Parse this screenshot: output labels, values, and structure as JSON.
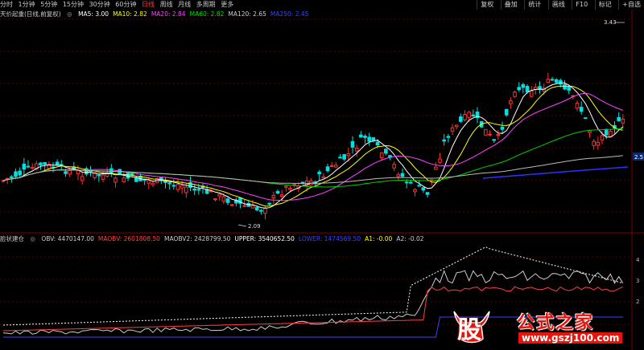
{
  "toolbar": {
    "periods": [
      "分时",
      "1分钟",
      "5分钟",
      "15分钟",
      "30分钟",
      "60分钟",
      "日线",
      "周线",
      "月线",
      "多周期",
      "更多"
    ],
    "active_period": "日线",
    "right_buttons": [
      "复权",
      "叠加",
      "统计",
      "画线",
      "F10",
      "标记",
      "+自选"
    ]
  },
  "main_panel": {
    "title": "天价起重(日线,前复权)",
    "ma": [
      {
        "label": "MA5: 3.00",
        "color": "#ffffff"
      },
      {
        "label": "MA10: 2.82",
        "color": "#ffff00"
      },
      {
        "label": "MA20: 2.84",
        "color": "#ff44ff"
      },
      {
        "label": "MA60: 2.82",
        "color": "#00e000"
      },
      {
        "label": "MA120: 2.65",
        "color": "#cccccc"
      },
      {
        "label": "MA250: 2.45",
        "color": "#4040ff"
      }
    ],
    "price_high_label": "3.43",
    "price_low_label": "2.09",
    "right_price": "2.5"
  },
  "indicator_panel": {
    "title": "脸状建仓",
    "values": [
      {
        "label": "OBV: 4470147.00",
        "color": "#cccccc"
      },
      {
        "label": "MAOBV: 2601808.50",
        "color": "#ff4040"
      },
      {
        "label": "MAOBV2: 2428799.50",
        "color": "#cccccc"
      },
      {
        "label": "UPPER: 3540652.50",
        "color": "#ffffff"
      },
      {
        "label": "LOWER: 1474569.50",
        "color": "#4040ff"
      },
      {
        "label": "A1: -0.00",
        "color": "#ffff00"
      },
      {
        "label": "A2: -0.02",
        "color": "#cccccc"
      }
    ],
    "right_ticks": [
      "4",
      "3",
      "2"
    ]
  },
  "watermark": {
    "logo_char": "股",
    "title": "公式之家",
    "url": "www.gszj100.com"
  },
  "colors": {
    "up": "#ff3030",
    "down": "#00e0e0",
    "grid": "#5a0000"
  }
}
